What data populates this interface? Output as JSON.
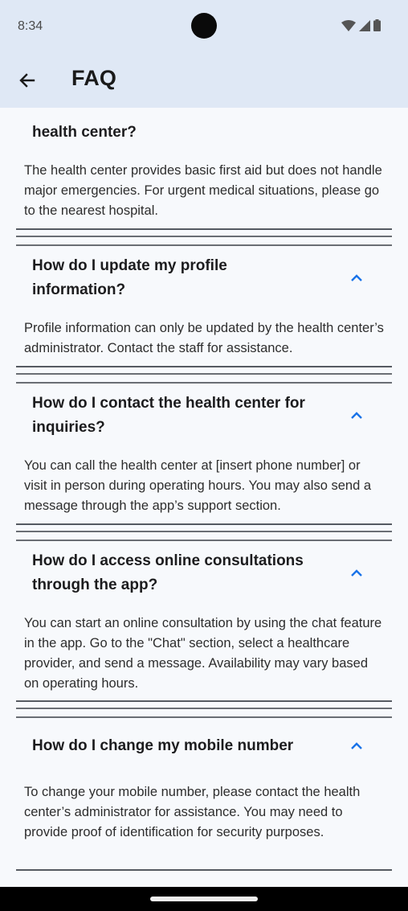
{
  "status": {
    "time": "8:34",
    "icons": [
      "wifi-icon",
      "signal-icon",
      "battery-icon"
    ]
  },
  "header": {
    "title": "FAQ",
    "back_icon": "arrow-left-icon"
  },
  "faq": [
    {
      "question": "health center?",
      "answer": "The health center provides basic first aid but does not handle major emergencies. For urgent medical situations, please go to the nearest hospital."
    },
    {
      "question": "How do I update my profile information?",
      "answer": "Profile information can only be updated by the health center’s administrator. Contact the staff for assistance."
    },
    {
      "question": "How do I contact the health center for inquiries?",
      "answer": "You can call the health center at [insert phone number] or visit in person during operating hours. You may also send a message through the app’s support section."
    },
    {
      "question": "How do I access online consultations through the app?",
      "answer": "You can start an online consultation by using the chat feature in the app. Go to the \"Chat\" section, select a healthcare provider, and send a message. Availability may vary based on operating hours."
    },
    {
      "question": "How do I change my mobile number",
      "answer": "To change your mobile number, please contact the health center’s administrator for assistance. You may need to provide proof of identification for security purposes."
    }
  ],
  "colors": {
    "app_bar": "#dfe8f5",
    "background": "#f7f9fc",
    "accent": "#1a73e8"
  }
}
